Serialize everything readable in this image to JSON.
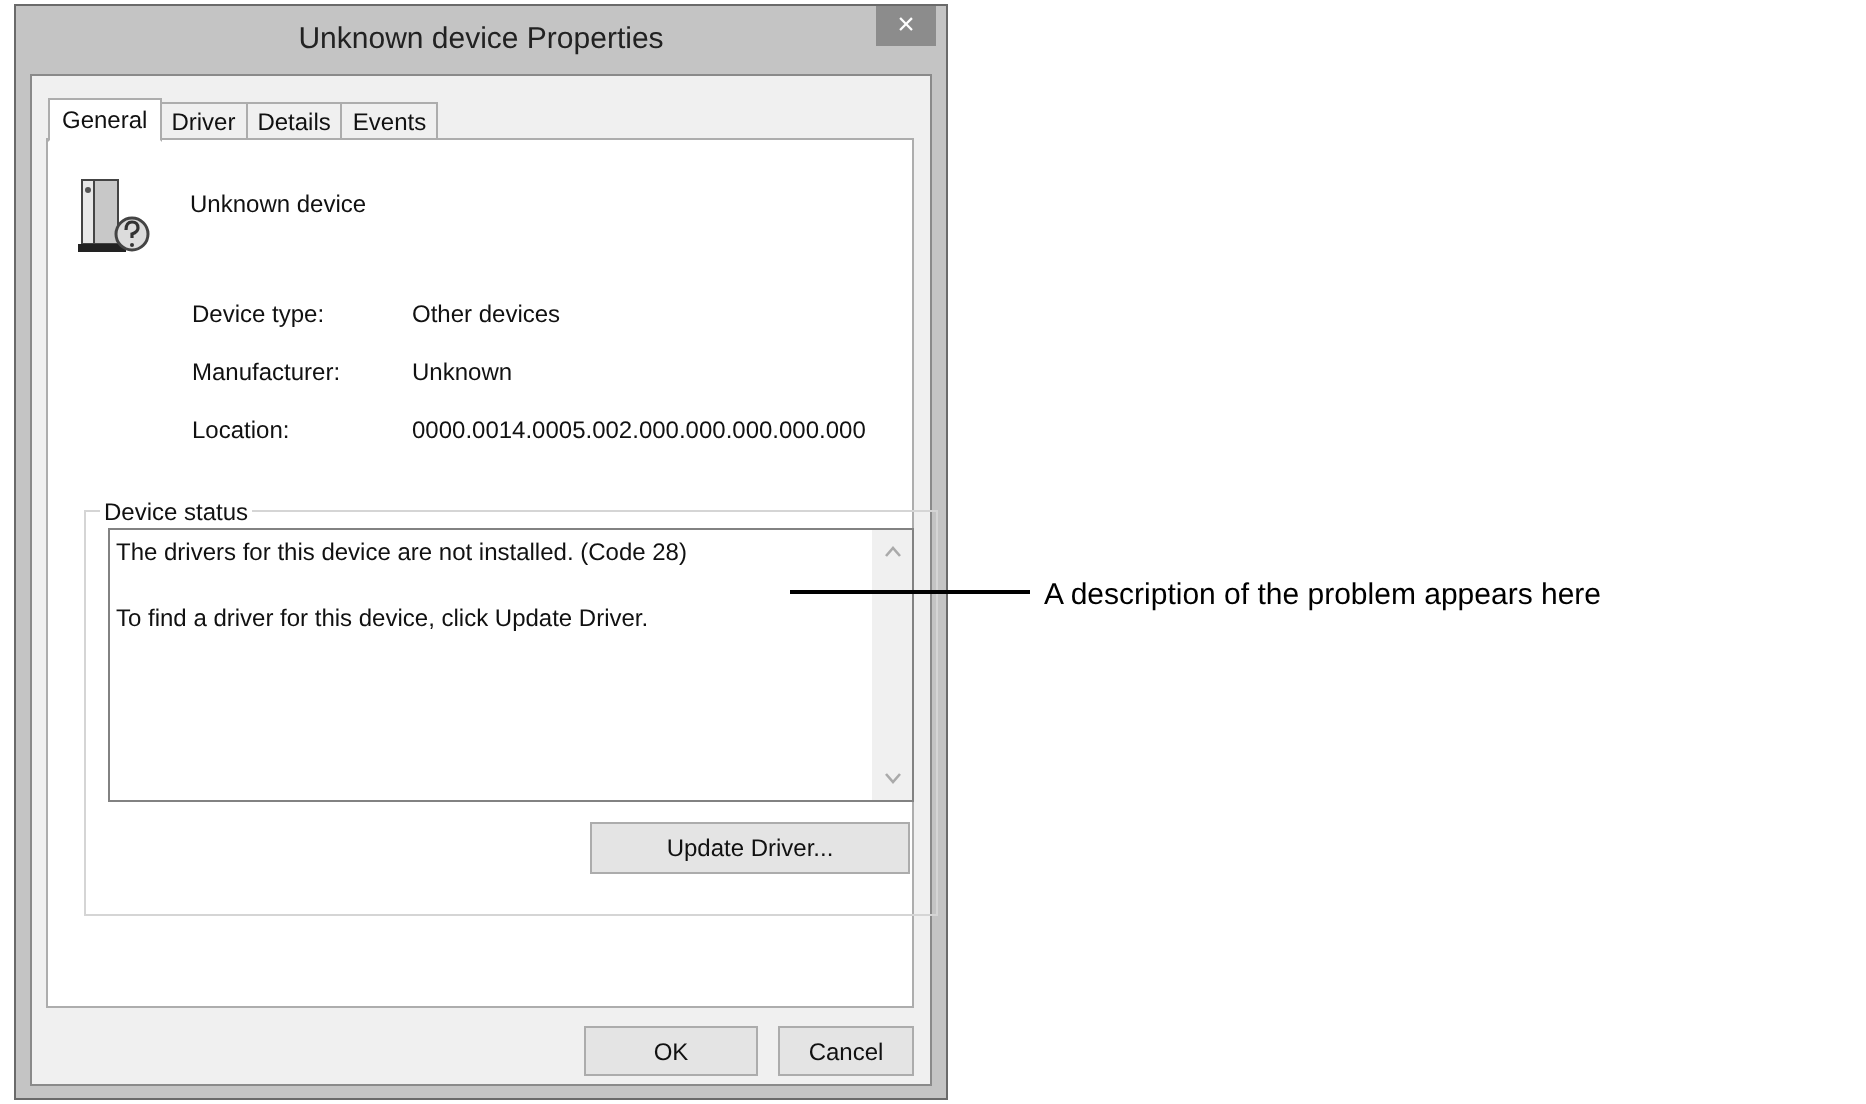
{
  "window": {
    "title": "Unknown device Properties",
    "close": "×"
  },
  "tabs": [
    {
      "label": "General",
      "selected": true
    },
    {
      "label": "Driver",
      "selected": false
    },
    {
      "label": "Details",
      "selected": false
    },
    {
      "label": "Events",
      "selected": false
    }
  ],
  "device": {
    "name": "Unknown device"
  },
  "properties": [
    {
      "label": "Device type:",
      "value": "Other devices"
    },
    {
      "label": "Manufacturer:",
      "value": "Unknown"
    },
    {
      "label": "Location:",
      "value": "0000.0014.0005.002.000.000.000.000.000"
    }
  ],
  "device_status": {
    "title": "Device status",
    "lines": [
      "The drivers for this device are not installed. (Code 28)",
      "To find a driver for this device, click Update Driver."
    ],
    "button": "Update Driver..."
  },
  "buttons": [
    "OK",
    "Cancel"
  ],
  "callout": {
    "text": "A description of the problem appears here"
  }
}
